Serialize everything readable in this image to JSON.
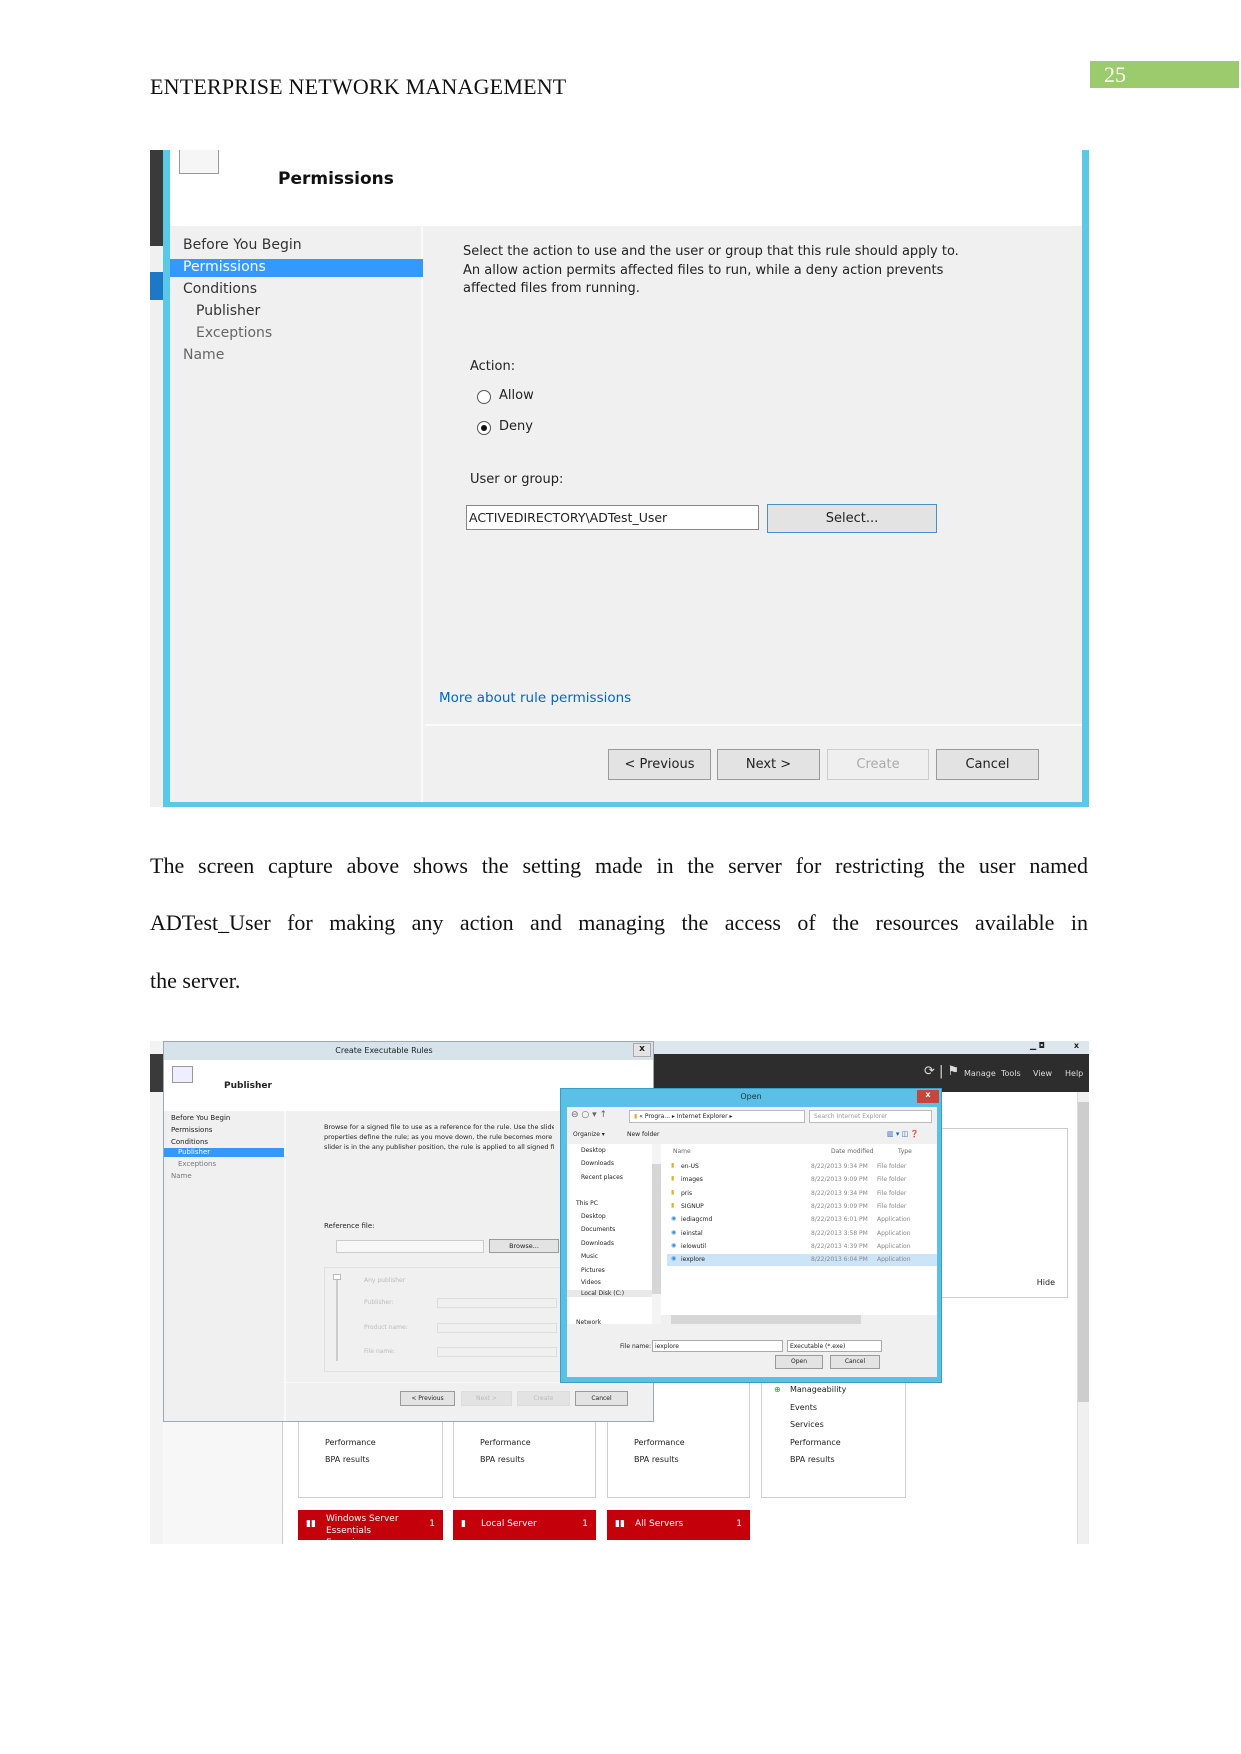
{
  "header": {
    "title": "ENTERPRISE NETWORK MANAGEMENT",
    "page_number": "25"
  },
  "shot1": {
    "heading": "Permissions",
    "nav": [
      "Before You Begin",
      "Permissions",
      "Conditions",
      "Publisher",
      "Exceptions",
      "Name"
    ],
    "selected_nav": "Permissions",
    "desc": [
      "Select the action to use and the user or group that this rule should apply to.",
      "An allow action permits affected files to run, while a deny action prevents",
      "affected files from running."
    ],
    "action_label": "Action:",
    "allow": "Allow",
    "deny": "Deny",
    "selected_action": "Deny",
    "user_label": "User or group:",
    "user_value": "ACTIVEDIRECTORY\\ADTest_User",
    "select_btn": "Select...",
    "link": "More about rule permissions",
    "buttons": {
      "previous": "< Previous",
      "next": "Next >",
      "create": "Create",
      "cancel": "Cancel"
    },
    "colors": {
      "accent": "#3399ff",
      "border": "#5bc8e8",
      "link": "#0066cc"
    }
  },
  "paragraph": [
    "The screen capture above shows the setting made in the server for restricting the user named",
    "ADTest_User for making any action and managing the access of the resources available in",
    "the server."
  ],
  "shot2": {
    "rules_title": "Create Executable Rules",
    "close": "x",
    "heading": "Publisher",
    "nav": [
      "Before You Begin",
      "Permissions",
      "Conditions",
      "Publisher",
      "Exceptions",
      "Name"
    ],
    "selected_nav": "Publisher",
    "desc": [
      "Browse for a signed file to use as a reference for the rule. Use the slider to",
      "properties define the rule; as you move down, the rule becomes more spe",
      "slider is in the any publisher position, the rule is applied to all signed files"
    ],
    "ref_label": "Reference file:",
    "browse": "Browse...",
    "slider_labels": [
      "Any publisher",
      "Publisher:",
      "Product name:",
      "File name:"
    ],
    "buttons": {
      "previous": "< Previous",
      "next": "Next >",
      "create": "Create",
      "cancel": "Cancel"
    },
    "server_menu": [
      "Manage",
      "Tools",
      "View",
      "Help"
    ],
    "hide": "Hide",
    "tiles": [
      [
        "Performance",
        "BPA results"
      ],
      [
        "Performance",
        "BPA results"
      ],
      [
        "Performance",
        "BPA results"
      ],
      [
        "Manageability",
        "Events",
        "Services",
        "Performance",
        "BPA results"
      ]
    ],
    "red_tiles": [
      {
        "label": "Windows Server Essentials Experience",
        "count": "1"
      },
      {
        "label": "Local Server",
        "count": "1"
      },
      {
        "label": "All Servers",
        "count": "1"
      }
    ],
    "open": {
      "title": "Open",
      "path": [
        "Progra...",
        "Internet Explorer"
      ],
      "search_placeholder": "Search Internet Explorer",
      "organize": "Organize ▾",
      "new_folder": "New folder",
      "nav": [
        "Desktop",
        "Downloads",
        "Recent places",
        "This PC",
        "Desktop",
        "Documents",
        "Downloads",
        "Music",
        "Pictures",
        "Videos",
        "Local Disk (C:)",
        "Network"
      ],
      "columns": [
        "Name",
        "Date modified",
        "Type"
      ],
      "files": [
        [
          "en-US",
          "8/22/2013 9:34 PM",
          "File folder"
        ],
        [
          "images",
          "8/22/2013 9:09 PM",
          "File folder"
        ],
        [
          "pris",
          "8/22/2013 9:34 PM",
          "File folder"
        ],
        [
          "SIGNUP",
          "8/22/2013 9:09 PM",
          "File folder"
        ],
        [
          "iediagcmd",
          "8/22/2013 6:01 PM",
          "Application"
        ],
        [
          "ieinstal",
          "8/22/2013 3:58 PM",
          "Application"
        ],
        [
          "ielowutil",
          "8/22/2013 4:39 PM",
          "Application"
        ],
        [
          "iexplore",
          "8/22/2013 6:04 PM",
          "Application"
        ]
      ],
      "selected_file": "iexplore",
      "file_name_label": "File name:",
      "file_name": "iexplore",
      "filter": "Executable (*.exe)",
      "open_btn": "Open",
      "cancel_btn": "Cancel"
    }
  }
}
